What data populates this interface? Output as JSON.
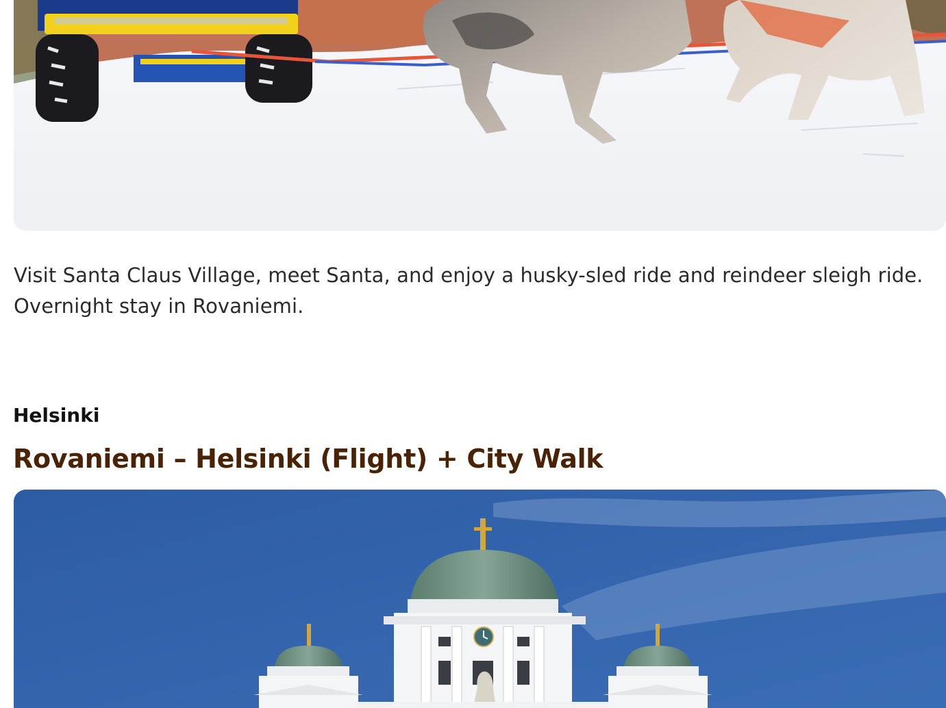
{
  "itinerary": {
    "day_photo_top": {
      "alt_icon": "husky-sled-photo"
    },
    "description": "Visit Santa Claus Village, meet Santa, and enjoy a husky-sled ride and reindeer sleigh ride. Overnight stay in Rovaniemi.",
    "next_day": {
      "location": "Helsinki",
      "title": "Rovaniemi – Helsinki (Flight) + City Walk",
      "photo_icon": "helsinki-cathedral-photo"
    }
  },
  "colors": {
    "title": "#4a2205",
    "text": "#2b2b2b",
    "sky": "#3563a8"
  }
}
